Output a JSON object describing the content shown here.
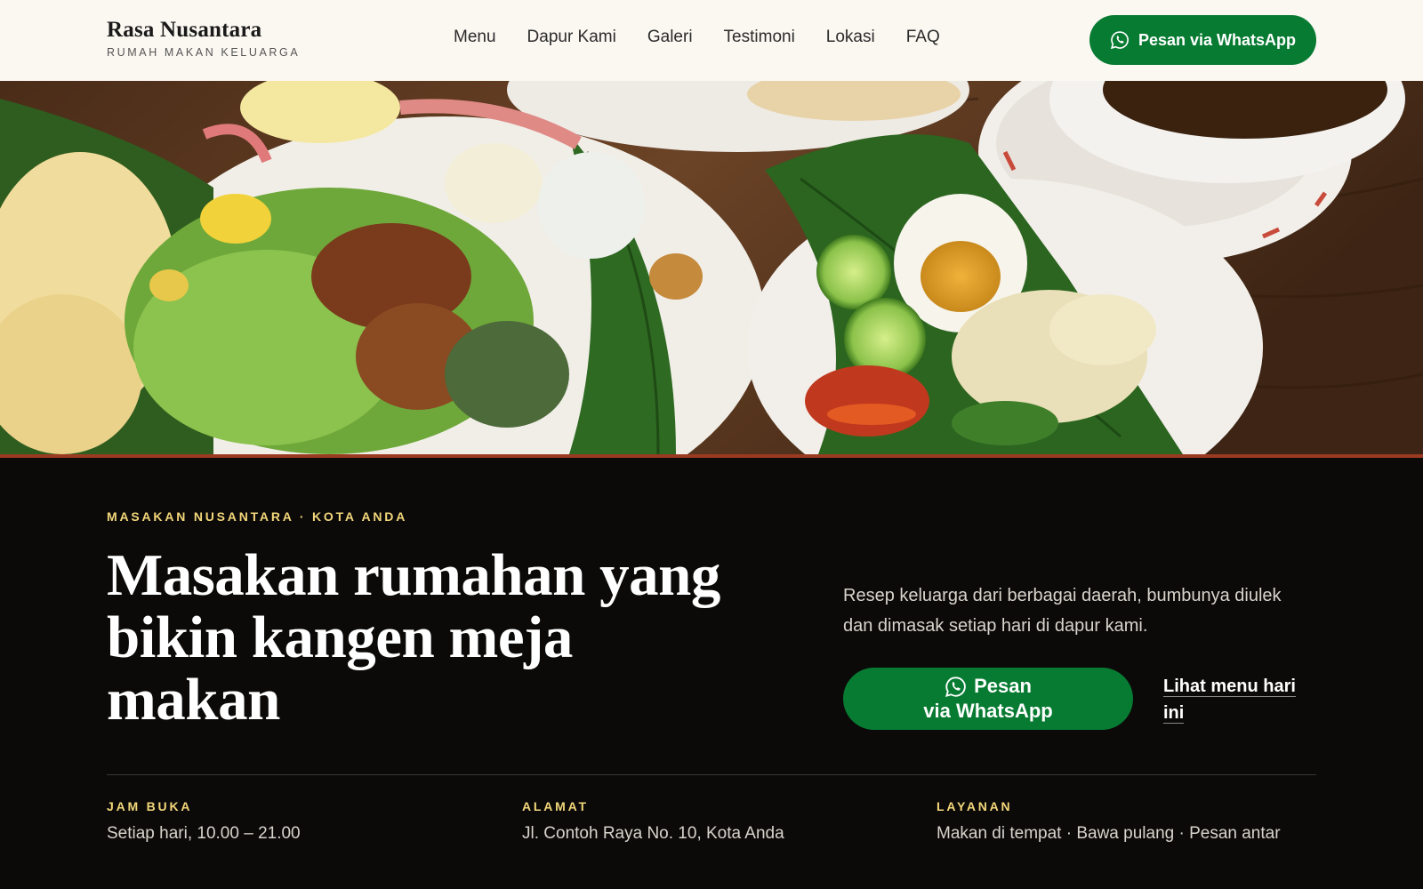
{
  "brand": {
    "name": "Rasa Nusantara",
    "tagline": "RUMAH MAKAN KELUARGA"
  },
  "nav": {
    "items": [
      "Menu",
      "Dapur Kami",
      "Galeri",
      "Testimoni",
      "Lokasi",
      "FAQ"
    ]
  },
  "header_cta": {
    "label": "Pesan via WhatsApp",
    "icon": "whatsapp-icon",
    "color": "#077b32"
  },
  "hero_image": {
    "subject": "food-photo"
  },
  "hero": {
    "eyebrow": "MASAKAN NUSANTARA · KOTA ANDA",
    "headline": "Masakan rumahan yang bikin kangen meja makan",
    "lead": "Resep keluarga dari berbagai daerah, bumbunya diulek dan dimasak setiap hari di dapur kami.",
    "cta_line1": "Pesan",
    "cta_line2": "via WhatsApp",
    "secondary_link": "Lihat menu hari ini"
  },
  "info": [
    {
      "label": "JAM BUKA",
      "value": "Setiap hari, 10.00 – 21.00"
    },
    {
      "label": "ALAMAT",
      "value": "Jl. Contoh Raya No. 10, Kota Anda"
    },
    {
      "label": "LAYANAN",
      "value": "Makan di tempat · Bawa pulang · Pesan antar"
    }
  ],
  "colors": {
    "accent_yellow": "#f3d77a",
    "brand_green": "#077b32",
    "dark_bg": "#0b0a09",
    "header_bg": "#fbf8f2"
  }
}
